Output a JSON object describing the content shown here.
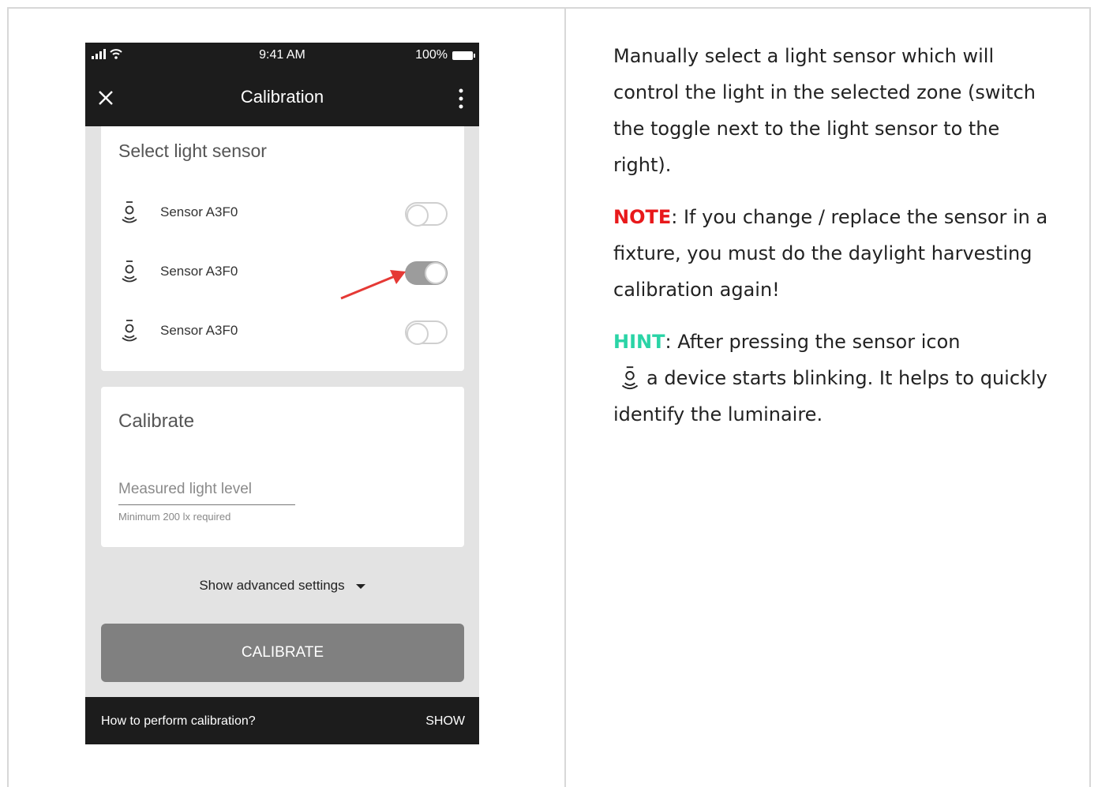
{
  "phone": {
    "status_bar": {
      "time": "9:41 AM",
      "battery": "100%"
    },
    "app_bar": {
      "title": "Calibration"
    },
    "select_card": {
      "heading": "Select light sensor",
      "sensors": [
        {
          "label": "Sensor A3F0",
          "enabled": false
        },
        {
          "label": "Sensor A3F0",
          "enabled": true
        },
        {
          "label": "Sensor A3F0",
          "enabled": false
        }
      ]
    },
    "calibrate_card": {
      "heading": "Calibrate",
      "input_placeholder": "Measured light level",
      "helper": "Minimum 200 lx required"
    },
    "advanced_label": "Show advanced settings",
    "calibrate_button": "CALIBRATE",
    "bottom_bar": {
      "question": "How to perform calibration?",
      "action": "SHOW"
    }
  },
  "instructions": {
    "paragraph1": "Manually select a light sensor which will control the light in the selected zone (switch the toggle  next to the light sensor to the right).",
    "note_label": "NOTE",
    "note_text": ": If you change / replace the sensor in a fixture, you must do the daylight harvesting calibration again!",
    "hint_label": "HINT",
    "hint_text_1": ": After pressing the sensor icon",
    "hint_text_2": "a device starts blinking. It helps to quickly identify the luminaire."
  },
  "colors": {
    "note": "#e8191b",
    "hint": "#2ad4a6",
    "arrow": "#e53935",
    "toggle_on": "#9c9c9c"
  }
}
